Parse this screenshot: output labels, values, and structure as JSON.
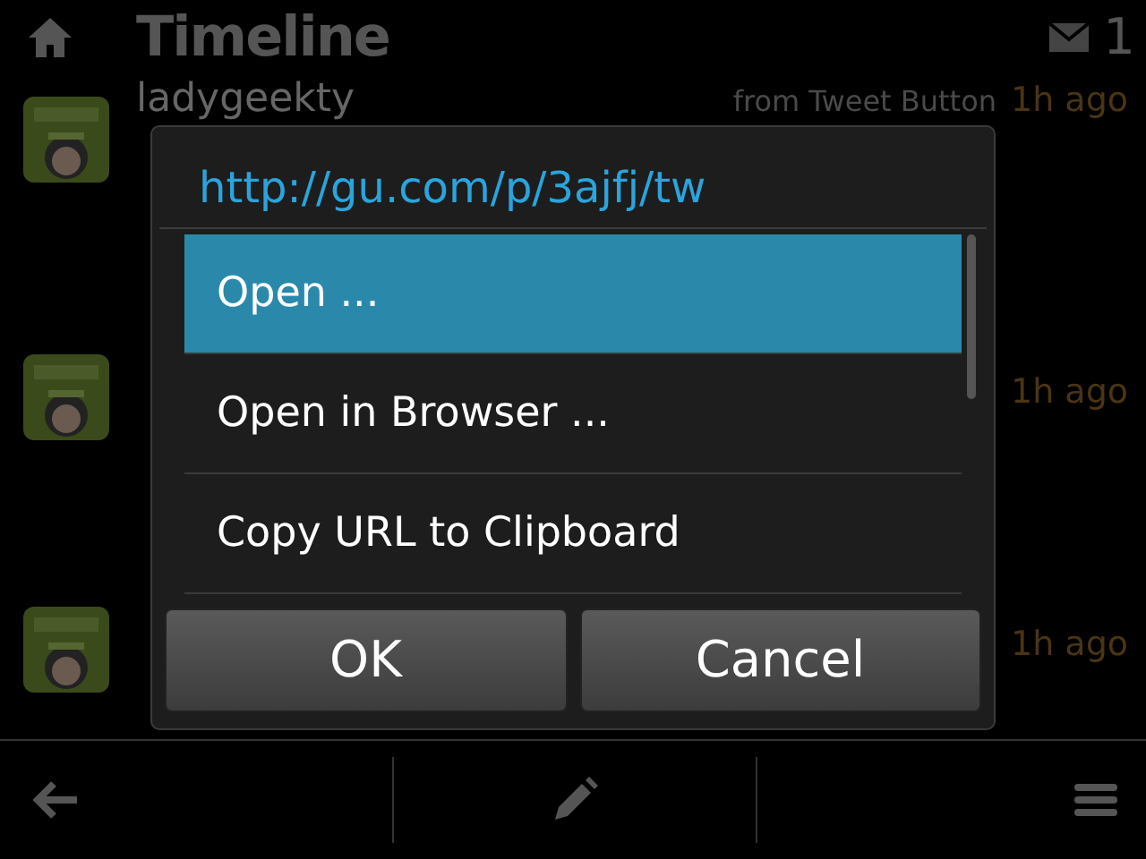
{
  "header": {
    "title": "Timeline",
    "unread_count": "1"
  },
  "tweets": [
    {
      "name": "ladygeekty",
      "source": "from Tweet Button",
      "time": "1h ago"
    },
    {
      "time": "1h ago"
    },
    {
      "time": "1h ago"
    }
  ],
  "dialog": {
    "title": "http://gu.com/p/3ajfj/tw",
    "items": [
      {
        "label": "Open ...",
        "selected": true
      },
      {
        "label": "Open in Browser ...",
        "selected": false
      },
      {
        "label": "Copy URL to Clipboard",
        "selected": false
      }
    ],
    "buttons": [
      "OK",
      "Cancel"
    ]
  }
}
